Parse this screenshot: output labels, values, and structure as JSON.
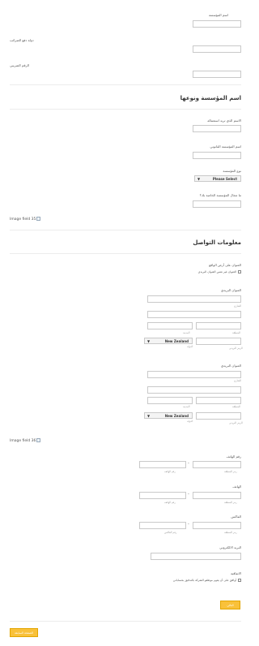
{
  "section1": {
    "org_name_label": "اسم المؤسسة",
    "tax_country_label": "دولة دفع الضرائب",
    "tax_number_label": "الرقم الضريبي"
  },
  "section2": {
    "title": "اسم المؤسسة ونوعها",
    "preferred_name_label": "الاسم الذي تريد استعماله",
    "legal_name_label": "اسم المؤسسة القانوني",
    "org_type_label": "نوع المؤسسة",
    "org_type_value": "Please Select",
    "field_of_work_label": "ما مجال المؤسسة الخاصة بك؟"
  },
  "image_field_1": "Image field 35",
  "section3": {
    "title": "معلومات التواصل",
    "physical_address_label": "العنوان على أرض الواقع",
    "different_postal_check": "العنوان غير نفس العنوان البريدي",
    "postal_address_label": "العنوان البريدي",
    "street_sublabel": "الشارع",
    "region_sublabel": "المنطقة",
    "city_sublabel": "المدينة",
    "postcode_sublabel": "الرمز البريدي",
    "country_sublabel": "الدولة",
    "country_value": "New Zealand",
    "postal_address2_label": "العنوان البريدي",
    "street2_sublabel": "الشارع",
    "region2_sublabel": "المنطقة",
    "city2_sublabel": "المدينة",
    "postcode2_sublabel": "الرمز البريدي",
    "country2_sublabel": "الدولة",
    "country2_value": "New Zealand"
  },
  "image_field_2": "Image field 36",
  "section4": {
    "phone_label": "رقم الهاتف",
    "area_code_sublabel": "رمز المنطقة",
    "phone_number_sublabel": "رقم الهاتف",
    "mobile_label": "الهاتف",
    "mobile_area_sublabel": "رمز المنطقة",
    "mobile_number_sublabel": "رقم الهاتف",
    "fax_label": "الفاكس",
    "fax_area_sublabel": "رمز المنطقة",
    "fax_number_sublabel": "رقم الفاكس",
    "email_label": "البريد الالكتروني",
    "agreement_label": "الاتفاقية",
    "agreement_check": "أوافق على أن يقوم موظفو الشركة بالتدقيق بحساباتي"
  },
  "buttons": {
    "next": "التالي",
    "prev": "الصفحة السابقة"
  }
}
